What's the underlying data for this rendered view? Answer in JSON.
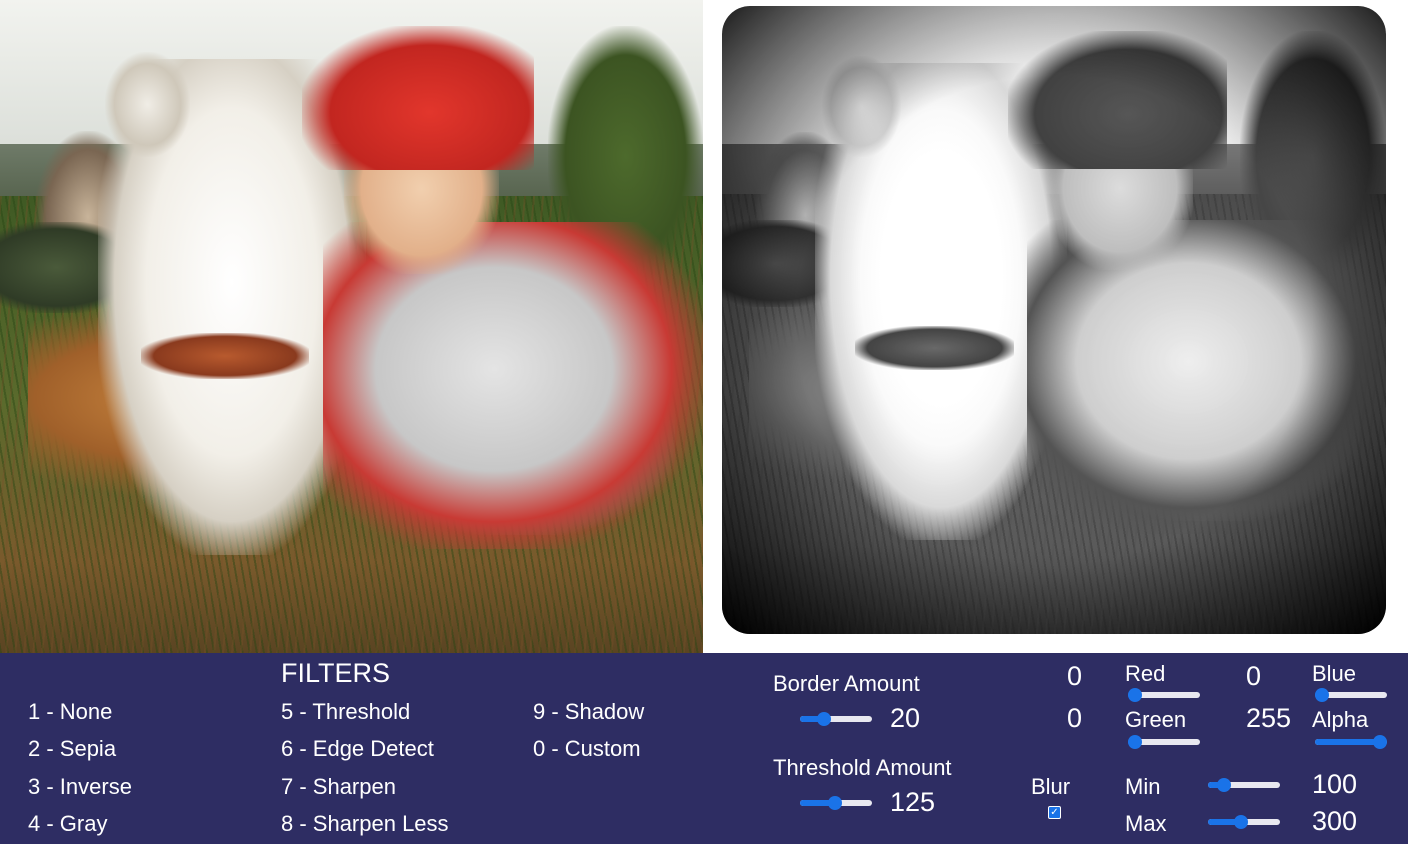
{
  "images": {
    "original_alt": "child-and-husky-photo",
    "filtered_alt": "filtered-grayscale-photo"
  },
  "filters": {
    "title": "FILTERS",
    "col1": [
      "1 - None",
      "2 - Sepia",
      "3 - Inverse",
      "4 - Gray"
    ],
    "col2": [
      "5 - Threshold",
      "6 - Edge Detect",
      "7 - Sharpen",
      "8 - Sharpen Less"
    ],
    "col3": [
      "9 - Shadow",
      "0 - Custom"
    ]
  },
  "controls": {
    "border": {
      "label": "Border Amount",
      "value": "20",
      "level": 0.3
    },
    "threshold": {
      "label": "Threshold Amount",
      "value": "125",
      "level": 0.49
    },
    "blur": {
      "label": "Blur",
      "checked": true
    },
    "red": {
      "label": "Red",
      "value": "0",
      "level": 0.0
    },
    "green": {
      "label": "Green",
      "value": "0",
      "level": 0.0
    },
    "blue": {
      "label": "Blue",
      "value": "0",
      "level": 0.0
    },
    "alpha": {
      "label": "Alpha",
      "value": "255",
      "level": 1.0
    },
    "min": {
      "label": "Min",
      "value": "100",
      "level": 0.15
    },
    "max": {
      "label": "Max",
      "value": "300",
      "level": 0.45
    }
  },
  "colors": {
    "panel_bg": "#2e2d63",
    "accent": "#1a73e8",
    "text": "#ffffff"
  }
}
